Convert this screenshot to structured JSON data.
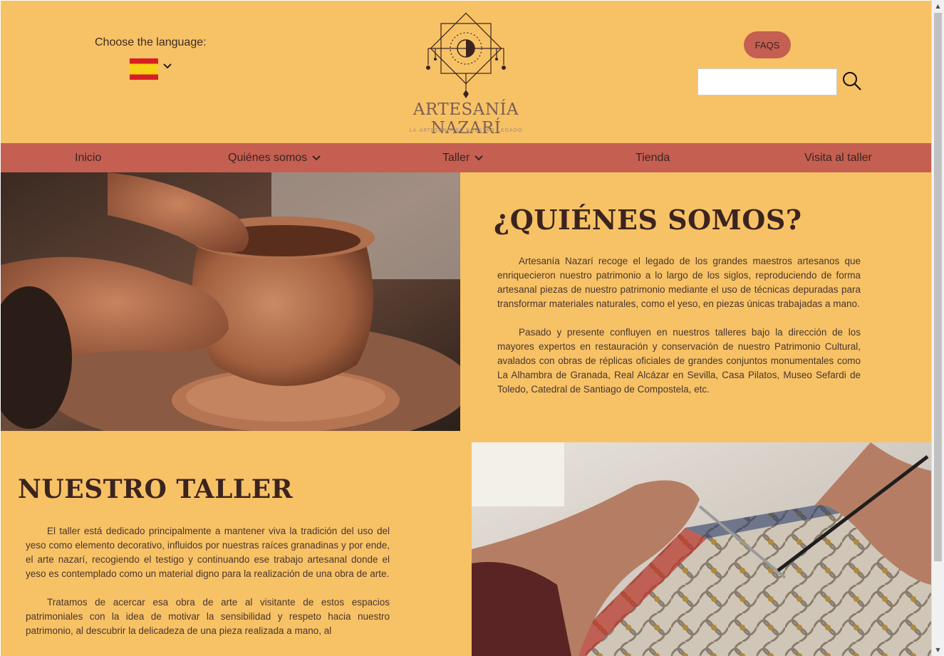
{
  "header": {
    "language_label": "Choose the language:",
    "selected_language_icon": "spain-flag-icon",
    "faq_label": "FAQS",
    "search_value": "",
    "search_icon": "search-icon"
  },
  "logo": {
    "title": "ARTESANÍA NAZARÍ",
    "tagline": "LA ARTESANÍA ES NUESTRO LEGADO"
  },
  "nav": {
    "items": [
      {
        "label": "Inicio",
        "has_dropdown": false
      },
      {
        "label": "Quiénes somos",
        "has_dropdown": true
      },
      {
        "label": "Taller",
        "has_dropdown": true
      },
      {
        "label": "Tienda",
        "has_dropdown": false
      },
      {
        "label": "Visita al taller",
        "has_dropdown": false
      }
    ]
  },
  "about": {
    "heading": "¿QUIÉNES SOMOS?",
    "paragraphs": [
      "Artesanía Nazarí recoge el legado de los grandes maestros artesanos que enriquecieron nuestro patrimonio a lo largo de los siglos, reproduciendo de forma artesanal piezas de nuestro patrimonio mediante el uso de técnicas depuradas para transformar materiales naturales, como el yeso, en piezas únicas trabajadas a mano.",
      "Pasado y presente confluyen en nuestros talleres bajo la dirección de los mayores expertos en restauración y conservación de nuestro Patrimonio Cultural, avalados con obras de réplicas oficiales de grandes conjuntos monumentales como La Alhambra de Granada, Real Alcázar en Sevilla, Casa Pilatos, Museo Sefardi de Toledo, Catedral de Santiago de Compostela, etc."
    ]
  },
  "workshop": {
    "heading": "NUESTRO TALLER",
    "paragraphs": [
      "El taller está dedicado principalmente a mantener viva la tradición del uso del yeso como elemento decorativo, influidos por nuestras raíces granadinas y por ende, el arte nazarí, recogiendo el testigo y continuando ese trabajo artesanal donde el yeso es contemplado como un material digno para la realización de una obra de arte.",
      "Tratamos de acercar esa obra de arte al visitante de estos espacios patrimoniales con la idea de motivar la sensibilidad y respeto hacia nuestro patrimonio, al descubrir la delicadeza de una pieza realizada a mano, al"
    ]
  },
  "colors": {
    "background": "#f7c265",
    "nav": "#c45f51",
    "heading": "#3b2420",
    "text": "#4a3530"
  }
}
